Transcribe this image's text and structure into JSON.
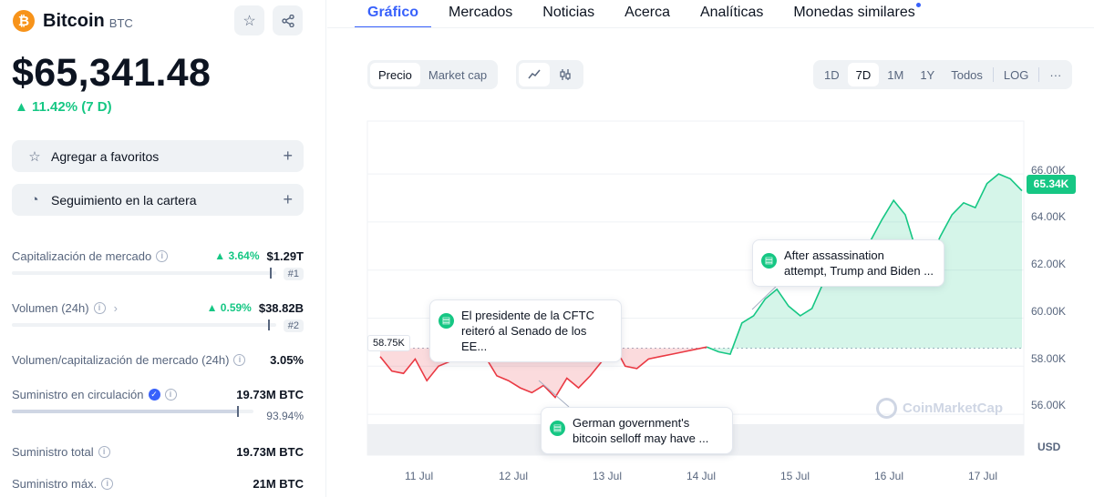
{
  "coin": {
    "name": "Bitcoin",
    "symbol": "BTC",
    "logo_glyph": "₿",
    "price": "$65,341.48",
    "change": "▲ 11.42% (7 D)"
  },
  "header_icons": {
    "star": "star-icon",
    "share": "share-icon"
  },
  "actions": [
    {
      "label": "Agregar a favoritos",
      "icon": "star-icon"
    },
    {
      "label": "Seguimiento en la cartera",
      "icon": "pie-chart-icon"
    }
  ],
  "stats": {
    "market_cap": {
      "label": "Capitalización de mercado",
      "pct": "▲ 3.64%",
      "value": "$1.29T",
      "rank": "#1"
    },
    "volume": {
      "label": "Volumen (24h)",
      "pct": "▲ 0.59%",
      "value": "$38.82B",
      "rank": "#2"
    },
    "vol_mcap": {
      "label": "Volumen/capitalización de mercado (24h)",
      "value": "3.05%"
    },
    "circulating": {
      "label": "Suministro en circulación",
      "value": "19.73M BTC",
      "pct": "93.94%",
      "fill": 0.9394
    },
    "total": {
      "label": "Suministro total",
      "value": "19.73M BTC"
    },
    "max": {
      "label": "Suministro máx.",
      "value": "21M BTC"
    }
  },
  "tabs": [
    "Gráfico",
    "Mercados",
    "Noticias",
    "Acerca",
    "Analíticas",
    "Monedas similares"
  ],
  "chart_type_toggle": [
    "Precio",
    "Market cap"
  ],
  "ranges": [
    "1D",
    "7D",
    "1M",
    "1Y",
    "Todos",
    "LOG",
    "···"
  ],
  "notes": [
    {
      "line1": "El presidente de la CFTC",
      "line2": "reiteró al Senado de los EE..."
    },
    {
      "line1": "German government's",
      "line2": "bitcoin selloff may have ..."
    },
    {
      "line1": "After assassination",
      "line2": "attempt, Trump and Biden ..."
    }
  ],
  "chart_data": {
    "type": "area",
    "currency_label": "USD",
    "x": [
      "11 Jul",
      "12 Jul",
      "13 Jul",
      "14 Jul",
      "15 Jul",
      "16 Jul",
      "17 Jul"
    ],
    "y_ticks": [
      "66.00K",
      "64.00K",
      "62.00K",
      "60.00K",
      "58.00K",
      "56.00K"
    ],
    "ylim": [
      54300,
      68200
    ],
    "open_value": 58750,
    "open_label": "58.75K",
    "current_label": "65.34K",
    "series": [
      {
        "values": [
          58400,
          57800,
          57700,
          58300,
          57400,
          58000,
          58200,
          58700,
          58900,
          58400,
          57600,
          57400,
          57100,
          56900,
          57200,
          56700,
          57500,
          57100,
          57600,
          58200,
          58900,
          58000,
          57900,
          58300,
          58400,
          58500,
          58600,
          58700,
          58800,
          58600,
          58500,
          59800,
          60100,
          60800,
          61200,
          60500,
          60100,
          60400,
          61500,
          62100,
          62800,
          62600,
          63200,
          64100,
          64900,
          64300,
          62700,
          62300,
          63400,
          64300,
          64800,
          64600,
          65600,
          66000,
          65800,
          65300
        ]
      }
    ],
    "colors": {
      "up": "#16c784",
      "down": "#ea3943"
    },
    "watermark": "CoinMarketCap"
  }
}
